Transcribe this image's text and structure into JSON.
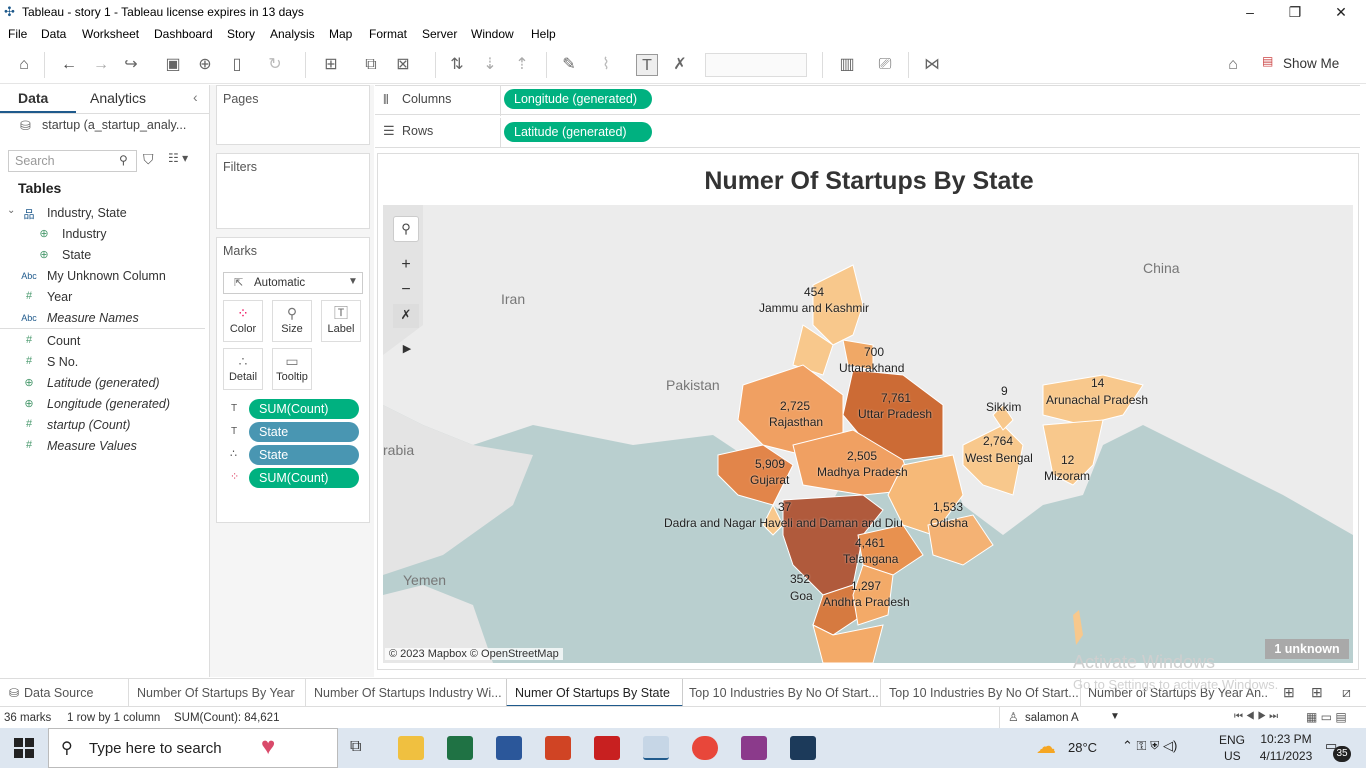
{
  "window": {
    "title": "Tableau - story  1 - Tableau license expires in 13 days"
  },
  "menu": [
    "File",
    "Data",
    "Worksheet",
    "Dashboard",
    "Story",
    "Analysis",
    "Map",
    "Format",
    "Server",
    "Window",
    "Help"
  ],
  "toolbar": {
    "show_me": "Show Me"
  },
  "data_pane": {
    "tab_data": "Data",
    "tab_analytics": "Analytics",
    "datasource": "startup (a_startup_analy...",
    "search_placeholder": "Search",
    "tables_header": "Tables",
    "fields": [
      {
        "icon": "hierarchy-icon",
        "label": "Industry, State",
        "italic": false
      },
      {
        "icon": "globe-icon",
        "label": "Industry",
        "italic": false
      },
      {
        "icon": "globe-icon",
        "label": "State",
        "italic": false
      },
      {
        "icon": "abc-icon",
        "label": "My Unknown Column",
        "italic": false
      },
      {
        "icon": "number-icon",
        "label": "Year",
        "italic": false
      },
      {
        "icon": "abc-icon",
        "label": "Measure Names",
        "italic": true
      },
      {
        "icon": "number-icon",
        "label": "Count",
        "italic": false
      },
      {
        "icon": "number-icon",
        "label": "S No.",
        "italic": false
      },
      {
        "icon": "globe-icon",
        "label": "Latitude (generated)",
        "italic": true
      },
      {
        "icon": "globe-icon",
        "label": "Longitude (generated)",
        "italic": true
      },
      {
        "icon": "number-icon",
        "label": "startup (Count)",
        "italic": true
      },
      {
        "icon": "number-icon",
        "label": "Measure Values",
        "italic": true
      }
    ],
    "icon_text": {
      "abc": "Abc",
      "num": "#",
      "globe": "⊕",
      "hier": "品"
    }
  },
  "shelves": {
    "pages": "Pages",
    "filters": "Filters",
    "marks": "Marks",
    "mark_type": "Automatic",
    "mark_buttons": [
      "Color",
      "Size",
      "Label",
      "Detail",
      "Tooltip"
    ],
    "mark_pills": [
      "SUM(Count)",
      "State",
      "State",
      "SUM(Count)"
    ],
    "columns_label": "Columns",
    "rows_label": "Rows",
    "columns_pill": "Longitude (generated)",
    "rows_pill": "Latitude (generated)"
  },
  "viz": {
    "title": "Numer Of Startups By State",
    "attribution": "© 2023 Mapbox © OpenStreetMap",
    "unknown": "1 unknown",
    "countries": [
      "Iran",
      "Pakistan",
      "China",
      "rabia",
      "Yemen"
    ],
    "states": [
      {
        "name": "Jammu and Kashmir",
        "value": "454"
      },
      {
        "name": "Uttarakhand",
        "value": "700"
      },
      {
        "name": "Uttar Pradesh",
        "value": "7,761"
      },
      {
        "name": "Rajasthan",
        "value": "2,725"
      },
      {
        "name": "Gujarat",
        "value": "5,909"
      },
      {
        "name": "Madhya Pradesh",
        "value": "2,505"
      },
      {
        "name": "West Bengal",
        "value": "2,764"
      },
      {
        "name": "Sikkim",
        "value": "9"
      },
      {
        "name": "Arunachal Pradesh",
        "value": "14"
      },
      {
        "name": "Mizoram",
        "value": "12"
      },
      {
        "name": "Odisha",
        "value": "1,533"
      },
      {
        "name": "Dadra and Nagar Haveli and Daman and Diu",
        "value": "37"
      },
      {
        "name": "Telangana",
        "value": "4,461"
      },
      {
        "name": "Goa",
        "value": "352"
      },
      {
        "name": "Andhra Pradesh",
        "value": "1,297"
      }
    ],
    "watermark1": "Activate Windows",
    "watermark2": "Go to Settings to activate Windows."
  },
  "sheet_tabs": {
    "data_source": "Data Source",
    "tabs": [
      "Number Of Startups By Year",
      "Number Of Startups Industry Wi...",
      "Numer Of Startups By State",
      "Top 10 Industries By No Of Start...",
      "Top 10 Industries By No Of Start...",
      "Number of Startups By Year An..."
    ]
  },
  "status": {
    "marks": "36 marks",
    "rows": "1 row by 1 column",
    "sum": "SUM(Count): 84,621",
    "user": "salamon  A"
  },
  "taskbar": {
    "search": "Type here to search",
    "temp": "28°C",
    "lang1": "ENG",
    "lang2": "US",
    "time": "10:23 PM",
    "date": "4/11/2023",
    "badge": "35"
  }
}
